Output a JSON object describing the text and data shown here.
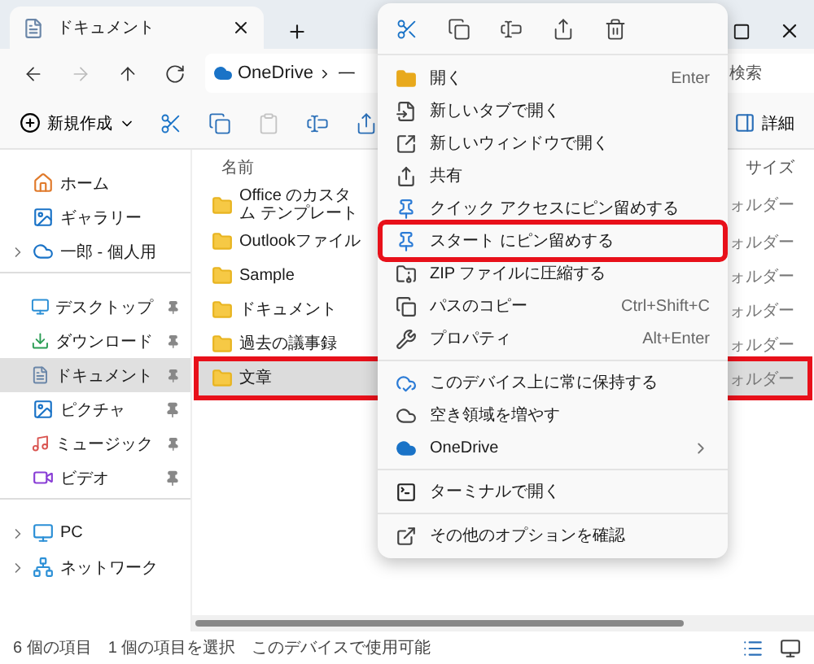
{
  "window": {
    "tab_title": "ドキュメント"
  },
  "navigation": {
    "forward_disabled": true,
    "location": "OneDrive",
    "location_next": "一",
    "search_placeholder": "検索"
  },
  "toolbar": {
    "new_label": "新規作成",
    "actions": [
      {
        "kind": "cut",
        "disabled": false
      },
      {
        "kind": "copy",
        "disabled": false
      },
      {
        "kind": "paste",
        "disabled": true
      },
      {
        "kind": "rename",
        "disabled": false
      },
      {
        "kind": "share",
        "disabled": false
      }
    ],
    "details_label": "詳細"
  },
  "sidebar": {
    "groups": [
      [
        {
          "kind": "home",
          "label": "ホーム",
          "selected": false,
          "pinned": false,
          "expandable": false
        },
        {
          "kind": "gallery",
          "label": "ギャラリー",
          "selected": false,
          "pinned": false,
          "expandable": false
        },
        {
          "kind": "cloud",
          "label": "一郎 - 個人用",
          "selected": false,
          "pinned": false,
          "expandable": true
        }
      ],
      [
        {
          "kind": "desktop",
          "label": "デスクトップ",
          "selected": false,
          "pinned": true,
          "expandable": false
        },
        {
          "kind": "download",
          "label": "ダウンロード",
          "selected": false,
          "pinned": true,
          "expandable": false
        },
        {
          "kind": "documents",
          "label": "ドキュメント",
          "selected": true,
          "pinned": true,
          "expandable": false
        },
        {
          "kind": "pictures",
          "label": "ピクチャ",
          "selected": false,
          "pinned": true,
          "expandable": false
        },
        {
          "kind": "music",
          "label": "ミュージック",
          "selected": false,
          "pinned": true,
          "expandable": false
        },
        {
          "kind": "videos",
          "label": "ビデオ",
          "selected": false,
          "pinned": true,
          "expandable": false
        }
      ],
      [
        {
          "kind": "pc",
          "label": "PC",
          "selected": false,
          "pinned": false,
          "expandable": true
        },
        {
          "kind": "network",
          "label": "ネットワーク",
          "selected": false,
          "pinned": false,
          "expandable": true
        }
      ]
    ]
  },
  "file_list": {
    "columns": [
      "名前",
      "サイズ"
    ],
    "rows": [
      {
        "name": "Office のカスタム テンプレート",
        "type": "ォルダー",
        "selected": false,
        "highlighted": false
      },
      {
        "name": "Outlookファイル",
        "type": "ォルダー",
        "selected": false,
        "highlighted": false
      },
      {
        "name": "Sample",
        "type": "ォルダー",
        "selected": false,
        "highlighted": false
      },
      {
        "name": "ドキュメント",
        "type": "ォルダー",
        "selected": false,
        "highlighted": false
      },
      {
        "name": "過去の議事録",
        "type": "ォルダー",
        "selected": false,
        "highlighted": false
      },
      {
        "name": "文章",
        "type": "ォルダー",
        "selected": true,
        "highlighted": true
      }
    ]
  },
  "status_bar": [
    "6 個の項目",
    "1 個の項目を選択",
    "このデバイスで使用可能"
  ],
  "context_menu": {
    "items": [
      {
        "kind": "item",
        "label": "開く",
        "shortcut": "Enter",
        "highlighted": false,
        "submenu": false
      },
      {
        "kind": "item",
        "label": "新しいタブで開く",
        "highlighted": false,
        "submenu": false
      },
      {
        "kind": "item",
        "label": "新しいウィンドウで開く",
        "highlighted": false,
        "submenu": false
      },
      {
        "kind": "item",
        "label": "共有",
        "highlighted": false,
        "submenu": false
      },
      {
        "kind": "item",
        "label": "クイック アクセスにピン留めする",
        "highlighted": false,
        "submenu": false
      },
      {
        "kind": "item",
        "label": "スタート にピン留めする",
        "highlighted": true,
        "submenu": false
      },
      {
        "kind": "item",
        "label": "ZIP ファイルに圧縮する",
        "highlighted": false,
        "submenu": false
      },
      {
        "kind": "item",
        "label": "パスのコピー",
        "shortcut": "Ctrl+Shift+C",
        "highlighted": false,
        "submenu": false
      },
      {
        "kind": "item",
        "label": "プロパティ",
        "shortcut": "Alt+Enter",
        "highlighted": false,
        "submenu": false
      },
      {
        "kind": "separator"
      },
      {
        "kind": "item",
        "label": "このデバイス上に常に保持する",
        "highlighted": false,
        "submenu": false
      },
      {
        "kind": "item",
        "label": "空き領域を増やす",
        "highlighted": false,
        "submenu": false
      },
      {
        "kind": "item",
        "label": "OneDrive",
        "highlighted": false,
        "submenu": true
      },
      {
        "kind": "separator"
      },
      {
        "kind": "item",
        "label": "ターミナルで開く",
        "highlighted": false,
        "submenu": false
      },
      {
        "kind": "separator"
      },
      {
        "kind": "item",
        "label": "その他のオプションを確認",
        "highlighted": false,
        "submenu": false
      }
    ]
  }
}
